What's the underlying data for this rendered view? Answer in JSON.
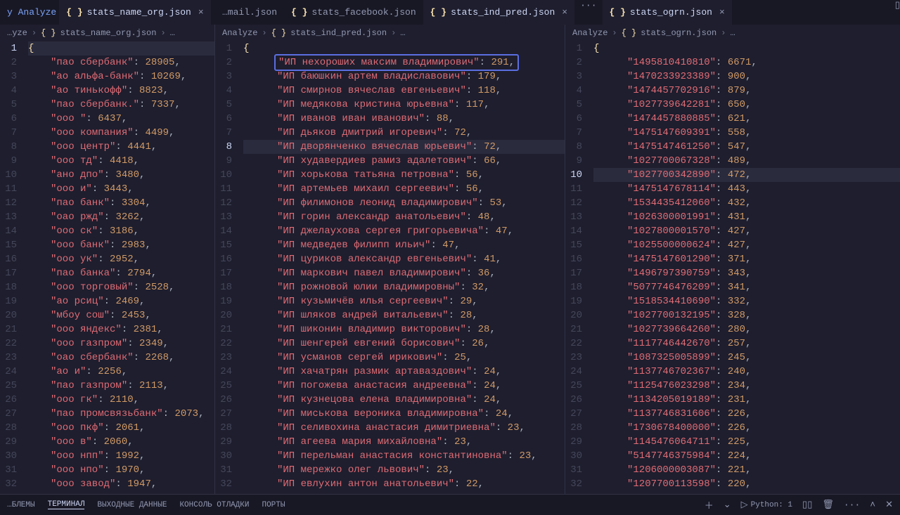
{
  "tabs": {
    "left": [
      {
        "label": "stats_name_org.json",
        "active": true
      }
    ],
    "mid_inactive": [
      {
        "label": "…mail.json"
      },
      {
        "label": "stats_facebook.json"
      }
    ],
    "mid_active": {
      "label": "stats_ind_pred.json"
    },
    "right": {
      "label": "stats_ogrn.json"
    }
  },
  "breadcrumb": {
    "left": {
      "root": "…yze",
      "file": "stats_name_org.json",
      "tail": "…"
    },
    "mid": {
      "root": "Analyze",
      "file": "stats_ind_pred.json",
      "tail": "…"
    },
    "right": {
      "root": "Analyze",
      "file": "stats_ogrn.json",
      "tail": "…"
    }
  },
  "panes": {
    "left": {
      "openBrace": "{",
      "entries": [
        {
          "k": "пао сбербанк",
          "v": 28905
        },
        {
          "k": "ао альфа-банк",
          "v": 10269
        },
        {
          "k": "ао тинькофф",
          "v": 8823
        },
        {
          "k": "пао сбербанк.",
          "v": 7337
        },
        {
          "k": "ооо ",
          "v": 6437
        },
        {
          "k": "ооо компания",
          "v": 4499
        },
        {
          "k": "ооо центр",
          "v": 4441
        },
        {
          "k": "ооо тд",
          "v": 4418
        },
        {
          "k": "ано дпо",
          "v": 3480
        },
        {
          "k": "ооо и",
          "v": 3443
        },
        {
          "k": "пао банк",
          "v": 3304
        },
        {
          "k": "оао ржд",
          "v": 3262
        },
        {
          "k": "ооо ск",
          "v": 3186
        },
        {
          "k": "ооо банк",
          "v": 2983
        },
        {
          "k": "ооо ук",
          "v": 2952
        },
        {
          "k": "пао банка",
          "v": 2794
        },
        {
          "k": "ооо торговый",
          "v": 2528
        },
        {
          "k": "ао рсиц",
          "v": 2469
        },
        {
          "k": "мбоу сош",
          "v": 2453
        },
        {
          "k": "ооо яндекс",
          "v": 2381
        },
        {
          "k": "ооо газпром",
          "v": 2349
        },
        {
          "k": "оао сбербанк",
          "v": 2268
        },
        {
          "k": "ао и",
          "v": 2256
        },
        {
          "k": "пао газпром",
          "v": 2113
        },
        {
          "k": "ооо гк",
          "v": 2110
        },
        {
          "k": "пао промсвязьбанк",
          "v": 2073
        },
        {
          "k": "ооо пкф",
          "v": 2061
        },
        {
          "k": "ооо в",
          "v": 2060
        },
        {
          "k": "ооо нпп",
          "v": 1992
        },
        {
          "k": "ооо нпо",
          "v": 1970
        },
        {
          "k": "ооо завод",
          "v": 1947
        }
      ],
      "activeLine": 1
    },
    "mid": {
      "openBrace": "{",
      "entries": [
        {
          "k": "ИП нехороших максим владимирович",
          "v": 291,
          "hl": true
        },
        {
          "k": "ИП баюшкин артем владиславович",
          "v": 179
        },
        {
          "k": "ИП смирнов вячеслав евгеньевич",
          "v": 118
        },
        {
          "k": "ИП медякова кристина юрьевна",
          "v": 117
        },
        {
          "k": "ИП иванов иван иванович",
          "v": 88
        },
        {
          "k": "ИП дьяков дмитрий игоревич",
          "v": 72
        },
        {
          "k": "ИП дворянченко вячеслав юрьевич",
          "v": 72
        },
        {
          "k": "ИП худавердиев рамиз адалетович",
          "v": 66
        },
        {
          "k": "ИП хорькова татьяна петровна",
          "v": 56
        },
        {
          "k": "ИП артемьев михаил сергеевич",
          "v": 56
        },
        {
          "k": "ИП филимонов леонид владимирович",
          "v": 53
        },
        {
          "k": "ИП горин александр анатольевич",
          "v": 48
        },
        {
          "k": "ИП джелаухова сергея григорьевича",
          "v": 47
        },
        {
          "k": "ИП медведев филипп ильич",
          "v": 47
        },
        {
          "k": "ИП цуриков александр евгеньевич",
          "v": 41
        },
        {
          "k": "ИП маркович павел владимирович",
          "v": 36
        },
        {
          "k": "ИП рожновой юлии владимировны",
          "v": 32
        },
        {
          "k": "ИП кузьмичёв илья сергеевич",
          "v": 29
        },
        {
          "k": "ИП шляков андрей витальевич",
          "v": 28
        },
        {
          "k": "ИП шиконин владимир викторович",
          "v": 28
        },
        {
          "k": "ИП шенгерей евгений борисович",
          "v": 26
        },
        {
          "k": "ИП усманов сергей ирикович",
          "v": 25
        },
        {
          "k": "ИП хачатрян размик артаваздович",
          "v": 24
        },
        {
          "k": "ИП погожева анастасия андреевна",
          "v": 24
        },
        {
          "k": "ИП кузнецова елена владимировна",
          "v": 24
        },
        {
          "k": "ИП миськова вероника владимировна",
          "v": 24
        },
        {
          "k": "ИП селивохина анастасия димитриевна",
          "v": 23
        },
        {
          "k": "ИП агеева мария михайловна",
          "v": 23
        },
        {
          "k": "ИП перельман анастасия константиновна",
          "v": 23
        },
        {
          "k": "ИП мережко олег львович",
          "v": 23
        },
        {
          "k": "ИП евлухин антон анатольевич",
          "v": 22
        }
      ],
      "activeLine": 8
    },
    "right": {
      "openBrace": "{",
      "entries": [
        {
          "k": "1495810410810",
          "v": 6671
        },
        {
          "k": "1470233923389",
          "v": 900
        },
        {
          "k": "1474457702916",
          "v": 879
        },
        {
          "k": "1027739642281",
          "v": 650
        },
        {
          "k": "1474457880885",
          "v": 621
        },
        {
          "k": "1475147609391",
          "v": 558
        },
        {
          "k": "1475147461250",
          "v": 547
        },
        {
          "k": "1027700067328",
          "v": 489
        },
        {
          "k": "1027700342890",
          "v": 472
        },
        {
          "k": "1475147678114",
          "v": 443
        },
        {
          "k": "1534435412060",
          "v": 432
        },
        {
          "k": "1026300001991",
          "v": 431
        },
        {
          "k": "1027800001570",
          "v": 427
        },
        {
          "k": "1025500000624",
          "v": 427
        },
        {
          "k": "1475147601290",
          "v": 371
        },
        {
          "k": "1496797390759",
          "v": 343
        },
        {
          "k": "5077746476209",
          "v": 341
        },
        {
          "k": "1518534410690",
          "v": 332
        },
        {
          "k": "1027700132195",
          "v": 328
        },
        {
          "k": "1027739664260",
          "v": 280
        },
        {
          "k": "1117746442670",
          "v": 257
        },
        {
          "k": "1087325005899",
          "v": 245
        },
        {
          "k": "1137746702367",
          "v": 240
        },
        {
          "k": "1125476023298",
          "v": 234
        },
        {
          "k": "1134205019189",
          "v": 231
        },
        {
          "k": "1137746831606",
          "v": 226
        },
        {
          "k": "1730678400000",
          "v": 226
        },
        {
          "k": "1145476064711",
          "v": 225
        },
        {
          "k": "5147746375984",
          "v": 224
        },
        {
          "k": "1206000003087",
          "v": 221
        },
        {
          "k": "1207700113598",
          "v": 220
        }
      ],
      "activeLine": 10
    }
  },
  "terminal": {
    "items": [
      "…БЛЕМЫ",
      "ТЕРМИНАЛ",
      "ВЫХОДНЫЕ ДАННЫЕ",
      "КОНСОЛЬ ОТЛАДКИ",
      "ПОРТЫ"
    ],
    "activeIdx": 1,
    "right": {
      "lang": "Python: 1"
    }
  },
  "icons": {
    "json": "{ }",
    "close": "×",
    "dots": "···",
    "split": "▯▯",
    "plus": "＋",
    "chev_down": "⌄",
    "term": "▷",
    "trash": "🗑",
    "up": "˄",
    "cross": "✕"
  }
}
